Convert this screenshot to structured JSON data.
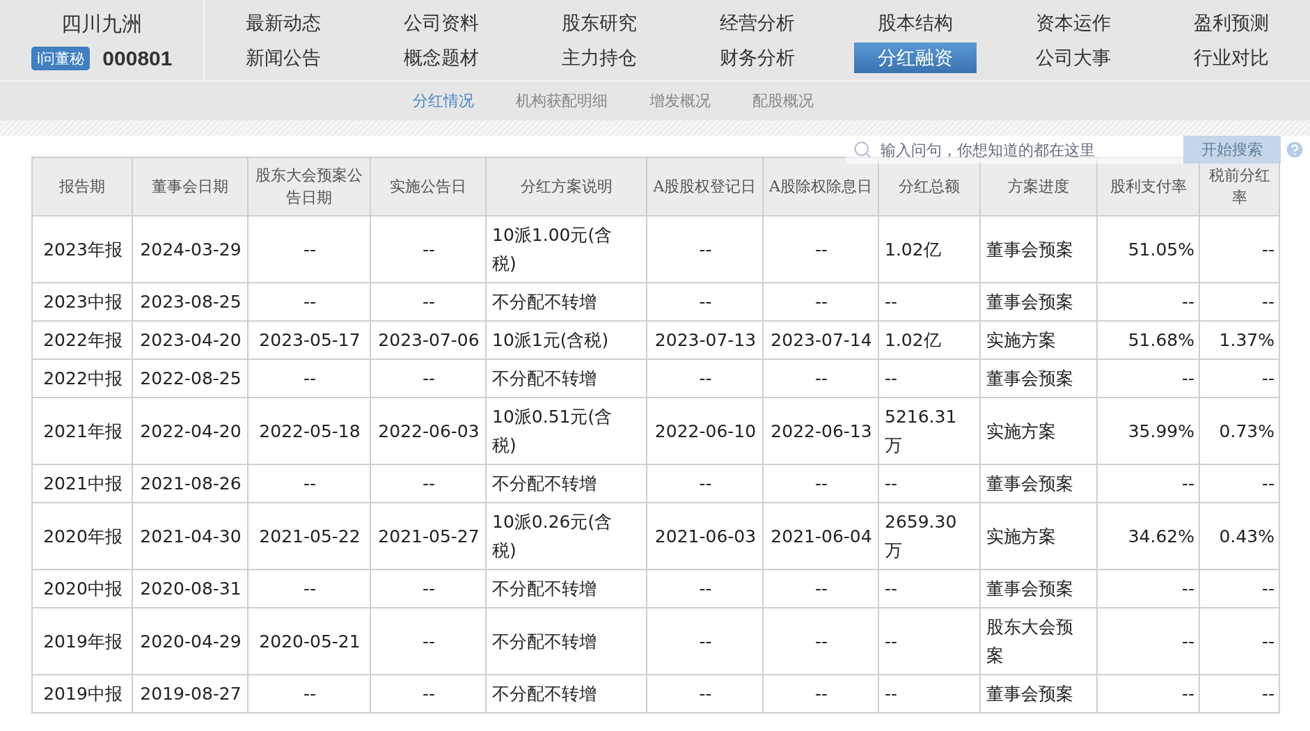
{
  "stock": {
    "name": "四川九洲",
    "badge": "i问董秘",
    "code": "000801"
  },
  "nav": [
    {
      "label": "最新动态",
      "selected": false
    },
    {
      "label": "公司资料",
      "selected": false
    },
    {
      "label": "股东研究",
      "selected": false
    },
    {
      "label": "经营分析",
      "selected": false
    },
    {
      "label": "股本结构",
      "selected": false
    },
    {
      "label": "资本运作",
      "selected": false
    },
    {
      "label": "盈利预测",
      "selected": false
    },
    {
      "label": "新闻公告",
      "selected": false
    },
    {
      "label": "概念题材",
      "selected": false
    },
    {
      "label": "主力持仓",
      "selected": false
    },
    {
      "label": "财务分析",
      "selected": false
    },
    {
      "label": "分红融资",
      "selected": true
    },
    {
      "label": "公司大事",
      "selected": false
    },
    {
      "label": "行业对比",
      "selected": false
    }
  ],
  "subnav": [
    {
      "label": "分红情况",
      "selected": true
    },
    {
      "label": "机构获配明细",
      "selected": false
    },
    {
      "label": "增发概况",
      "selected": false
    },
    {
      "label": "配股概况",
      "selected": false
    }
  ],
  "search": {
    "placeholder": "输入问句，你想知道的都在这里",
    "button": "开始搜索"
  },
  "table": {
    "columns": [
      "报告期",
      "董事会日期",
      "股东大会预案公告日期",
      "实施公告日",
      "分红方案说明",
      "A股股权登记日",
      "A股除权除息日",
      "分红总额",
      "方案进度",
      "股利支付率",
      "税前分红率"
    ],
    "rows": [
      [
        "2023年报",
        "2024-03-29",
        "--",
        "--",
        "10派1.00元(含税)",
        "--",
        "--",
        "1.02亿",
        "董事会预案",
        "51.05%",
        "--"
      ],
      [
        "2023中报",
        "2023-08-25",
        "--",
        "--",
        "不分配不转增",
        "--",
        "--",
        "--",
        "董事会预案",
        "--",
        "--"
      ],
      [
        "2022年报",
        "2023-04-20",
        "2023-05-17",
        "2023-07-06",
        "10派1元(含税)",
        "2023-07-13",
        "2023-07-14",
        "1.02亿",
        "实施方案",
        "51.68%",
        "1.37%"
      ],
      [
        "2022中报",
        "2022-08-25",
        "--",
        "--",
        "不分配不转增",
        "--",
        "--",
        "--",
        "董事会预案",
        "--",
        "--"
      ],
      [
        "2021年报",
        "2022-04-20",
        "2022-05-18",
        "2022-06-03",
        "10派0.51元(含税)",
        "2022-06-10",
        "2022-06-13",
        "5216.31万",
        "实施方案",
        "35.99%",
        "0.73%"
      ],
      [
        "2021中报",
        "2021-08-26",
        "--",
        "--",
        "不分配不转增",
        "--",
        "--",
        "--",
        "董事会预案",
        "--",
        "--"
      ],
      [
        "2020年报",
        "2021-04-30",
        "2021-05-22",
        "2021-05-27",
        "10派0.26元(含税)",
        "2021-06-03",
        "2021-06-04",
        "2659.30万",
        "实施方案",
        "34.62%",
        "0.43%"
      ],
      [
        "2020中报",
        "2020-08-31",
        "--",
        "--",
        "不分配不转增",
        "--",
        "--",
        "--",
        "董事会预案",
        "--",
        "--"
      ],
      [
        "2019年报",
        "2020-04-29",
        "2020-05-21",
        "--",
        "不分配不转增",
        "--",
        "--",
        "--",
        "股东大会预案",
        "--",
        "--"
      ],
      [
        "2019中报",
        "2019-08-27",
        "--",
        "--",
        "不分配不转增",
        "--",
        "--",
        "--",
        "董事会预案",
        "--",
        "--"
      ]
    ]
  }
}
